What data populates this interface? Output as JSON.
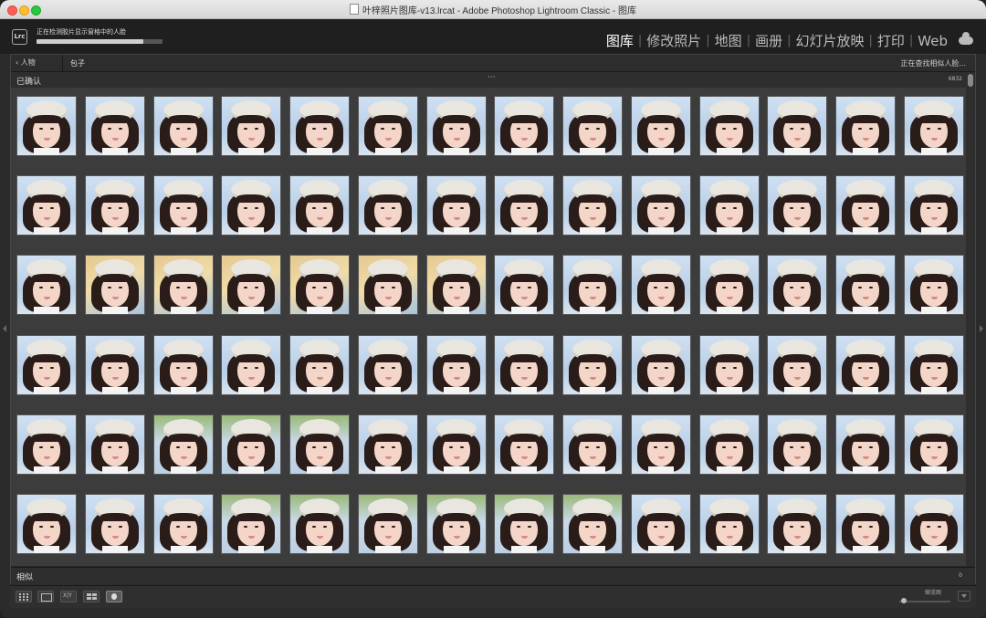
{
  "window": {
    "title": "叶梓照片图库-v13.lrcat - Adobe Photoshop Lightroom Classic - 图库"
  },
  "topbar": {
    "logo": "Lrc",
    "status_text": "正在检测胶片显示窗格中的人脸",
    "progress_fraction": 0.85,
    "modules": [
      {
        "label": "图库",
        "active": true
      },
      {
        "label": "修改照片",
        "active": false
      },
      {
        "label": "地图",
        "active": false
      },
      {
        "label": "画册",
        "active": false
      },
      {
        "label": "幻灯片放映",
        "active": false
      },
      {
        "label": "打印",
        "active": false
      },
      {
        "label": "Web",
        "active": false
      }
    ],
    "cloud_icon": "cloud-icon"
  },
  "crumb": {
    "back_label": "人物",
    "person_name": "包子",
    "status": "正在查找相似人脸..."
  },
  "confirmed": {
    "title": "已确认",
    "dots": "···",
    "count": "6832"
  },
  "similar": {
    "title": "相似",
    "count": "0"
  },
  "grid": {
    "columns": 14,
    "rows": 6,
    "variants": [
      [
        "blue",
        "blue",
        "blue",
        "blue",
        "blue",
        "blue",
        "blue",
        "blue",
        "blue",
        "blue",
        "blue",
        "blue",
        "blue",
        "blue"
      ],
      [
        "blue",
        "blue",
        "blue",
        "blue",
        "blue",
        "blue",
        "blue",
        "blue",
        "blue",
        "blue",
        "blue",
        "blue",
        "blue",
        "blue"
      ],
      [
        "blue",
        "warm",
        "warm",
        "warm",
        "warm",
        "warm",
        "warm",
        "blue",
        "blue",
        "blue",
        "blue",
        "blue",
        "blue",
        "blue"
      ],
      [
        "blue",
        "blue",
        "blue",
        "blue",
        "blue",
        "blue",
        "blue",
        "blue",
        "blue",
        "blue",
        "blue",
        "blue",
        "blue",
        "blue"
      ],
      [
        "blue",
        "blue",
        "tree",
        "tree",
        "tree",
        "blue",
        "blue",
        "blue",
        "blue",
        "blue",
        "blue",
        "blue",
        "blue",
        "blue"
      ],
      [
        "blue",
        "blue",
        "blue",
        "tree",
        "tree",
        "tree",
        "tree",
        "tree",
        "tree",
        "blue",
        "blue",
        "blue",
        "blue",
        "blue"
      ]
    ]
  },
  "toolbar": {
    "compare_label": "X|Y",
    "thumbnail_label": "缩览图",
    "thumbnail_size_fraction": 0.05
  }
}
